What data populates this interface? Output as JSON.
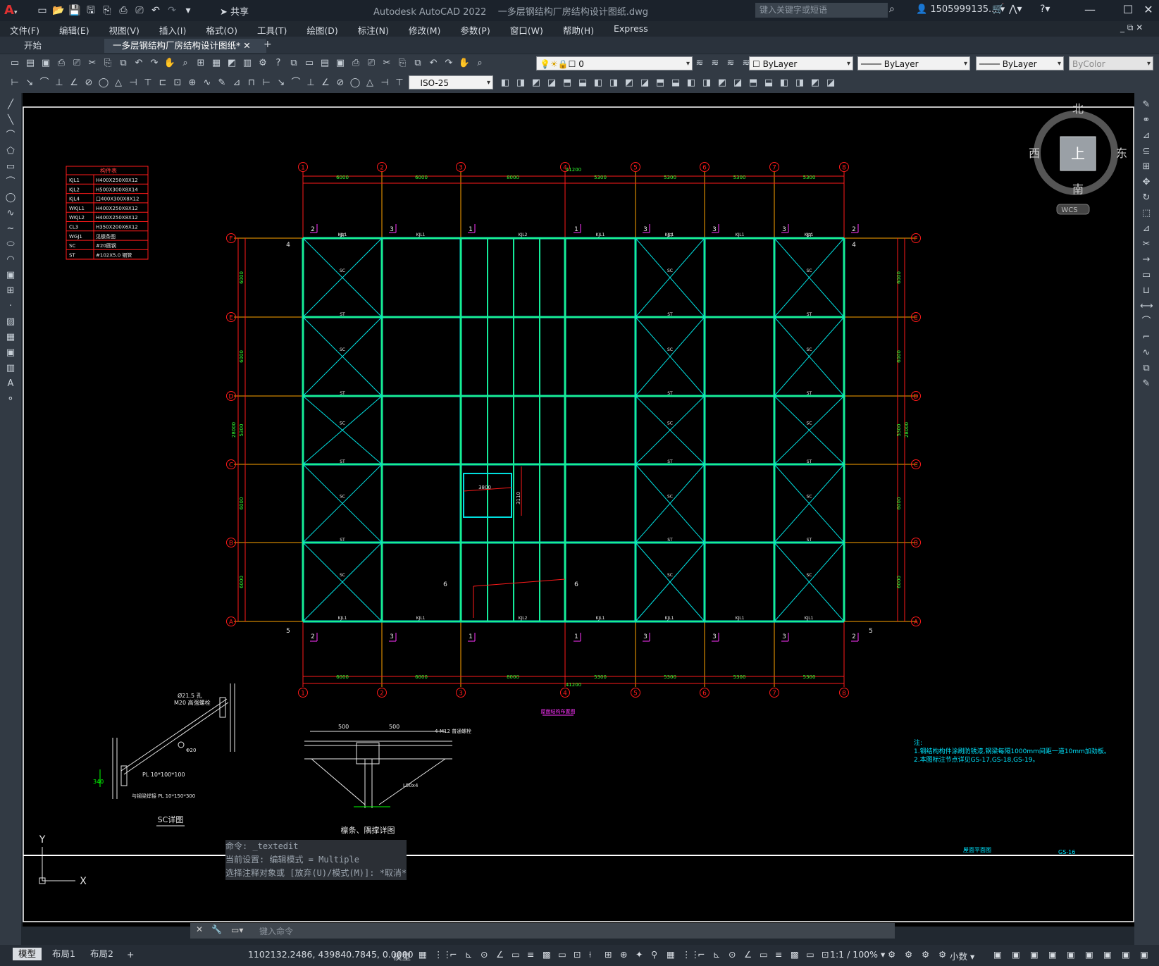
{
  "app": {
    "title": "Autodesk AutoCAD 2022",
    "document": "一多层钢结构厂房结构设计图纸.dwg",
    "share_label": "共享",
    "search_placeholder": "键入关键字或短语",
    "user": "1505999135..."
  },
  "menu": [
    "文件(F)",
    "编辑(E)",
    "视图(V)",
    "插入(I)",
    "格式(O)",
    "工具(T)",
    "绘图(D)",
    "标注(N)",
    "修改(M)",
    "参数(P)",
    "窗口(W)",
    "帮助(H)",
    "Express"
  ],
  "tabs": [
    {
      "label": "开始"
    },
    {
      "label": "一多层钢结构厂房结构设计图纸*"
    }
  ],
  "layer_combo": "0",
  "color_combo": "ByLayer",
  "linetype_combo": "ByLayer",
  "lineweight_combo": "ByLayer",
  "plotstyle_combo": "ByColor",
  "dimstyle_combo": "ISO-25",
  "viewcube": {
    "north": "北",
    "south": "南",
    "east": "东",
    "west": "西",
    "top": "上",
    "wcs": "WCS"
  },
  "command_history": [
    "命令: _textedit",
    "当前设置: 编辑模式 = Multiple",
    "选择注释对象或 [放弃(U)/模式(M)]: *取消*"
  ],
  "command_placeholder": "键入命令",
  "ucs": {
    "y": "Y",
    "x": "X"
  },
  "layout_tabs": [
    "模型",
    "布局1",
    "布局2"
  ],
  "status": {
    "coords": "1102132.2486, 439840.7845, 0.0000",
    "model": "模型",
    "scale": "1:1 / 100%",
    "units": "小数"
  },
  "drawing": {
    "legend_title": "构件表",
    "legend_rows": [
      [
        "KJL1",
        "H400X250X8X12"
      ],
      [
        "KJL2",
        "H500X300X8X14"
      ],
      [
        "KJL4",
        "口400X300X8X12"
      ],
      [
        "WKJL1",
        "H400X250X8X12"
      ],
      [
        "WKJL2",
        "H400X250X8X12"
      ],
      [
        "CL3",
        "H350X200X6X12"
      ],
      [
        "WGJ1",
        "见檩条图"
      ],
      [
        "SC",
        "#20圆钢"
      ],
      [
        "ST",
        "#102X5.0 钢管"
      ]
    ],
    "column_axes": [
      "1",
      "2",
      "3",
      "4",
      "5",
      "6",
      "7",
      "8"
    ],
    "row_axes": [
      "A",
      "B",
      "C",
      "D",
      "E",
      "F"
    ],
    "bay_dims": [
      "6000",
      "6000",
      "8000",
      "5300",
      "5300",
      "5300",
      "5300"
    ],
    "total_width": "41200",
    "row_dims": [
      "6000",
      "6000",
      "5300",
      "6000",
      "6000"
    ],
    "total_height": "28000",
    "plan_title": "屋面结构布置图",
    "detail1_title": "SC详图",
    "detail2_title": "檩条、隅撑详图",
    "notes_title": "注:",
    "note1": "1.钢结构构件涂刷防锈漆,钢梁每隔1000mm间距一道10mm加劲板。",
    "note2": "2.本图标注节点详见GS-17,GS-18,GS-19。",
    "sheet_title": "屋面平面图",
    "sheet_no": "GS-16"
  }
}
